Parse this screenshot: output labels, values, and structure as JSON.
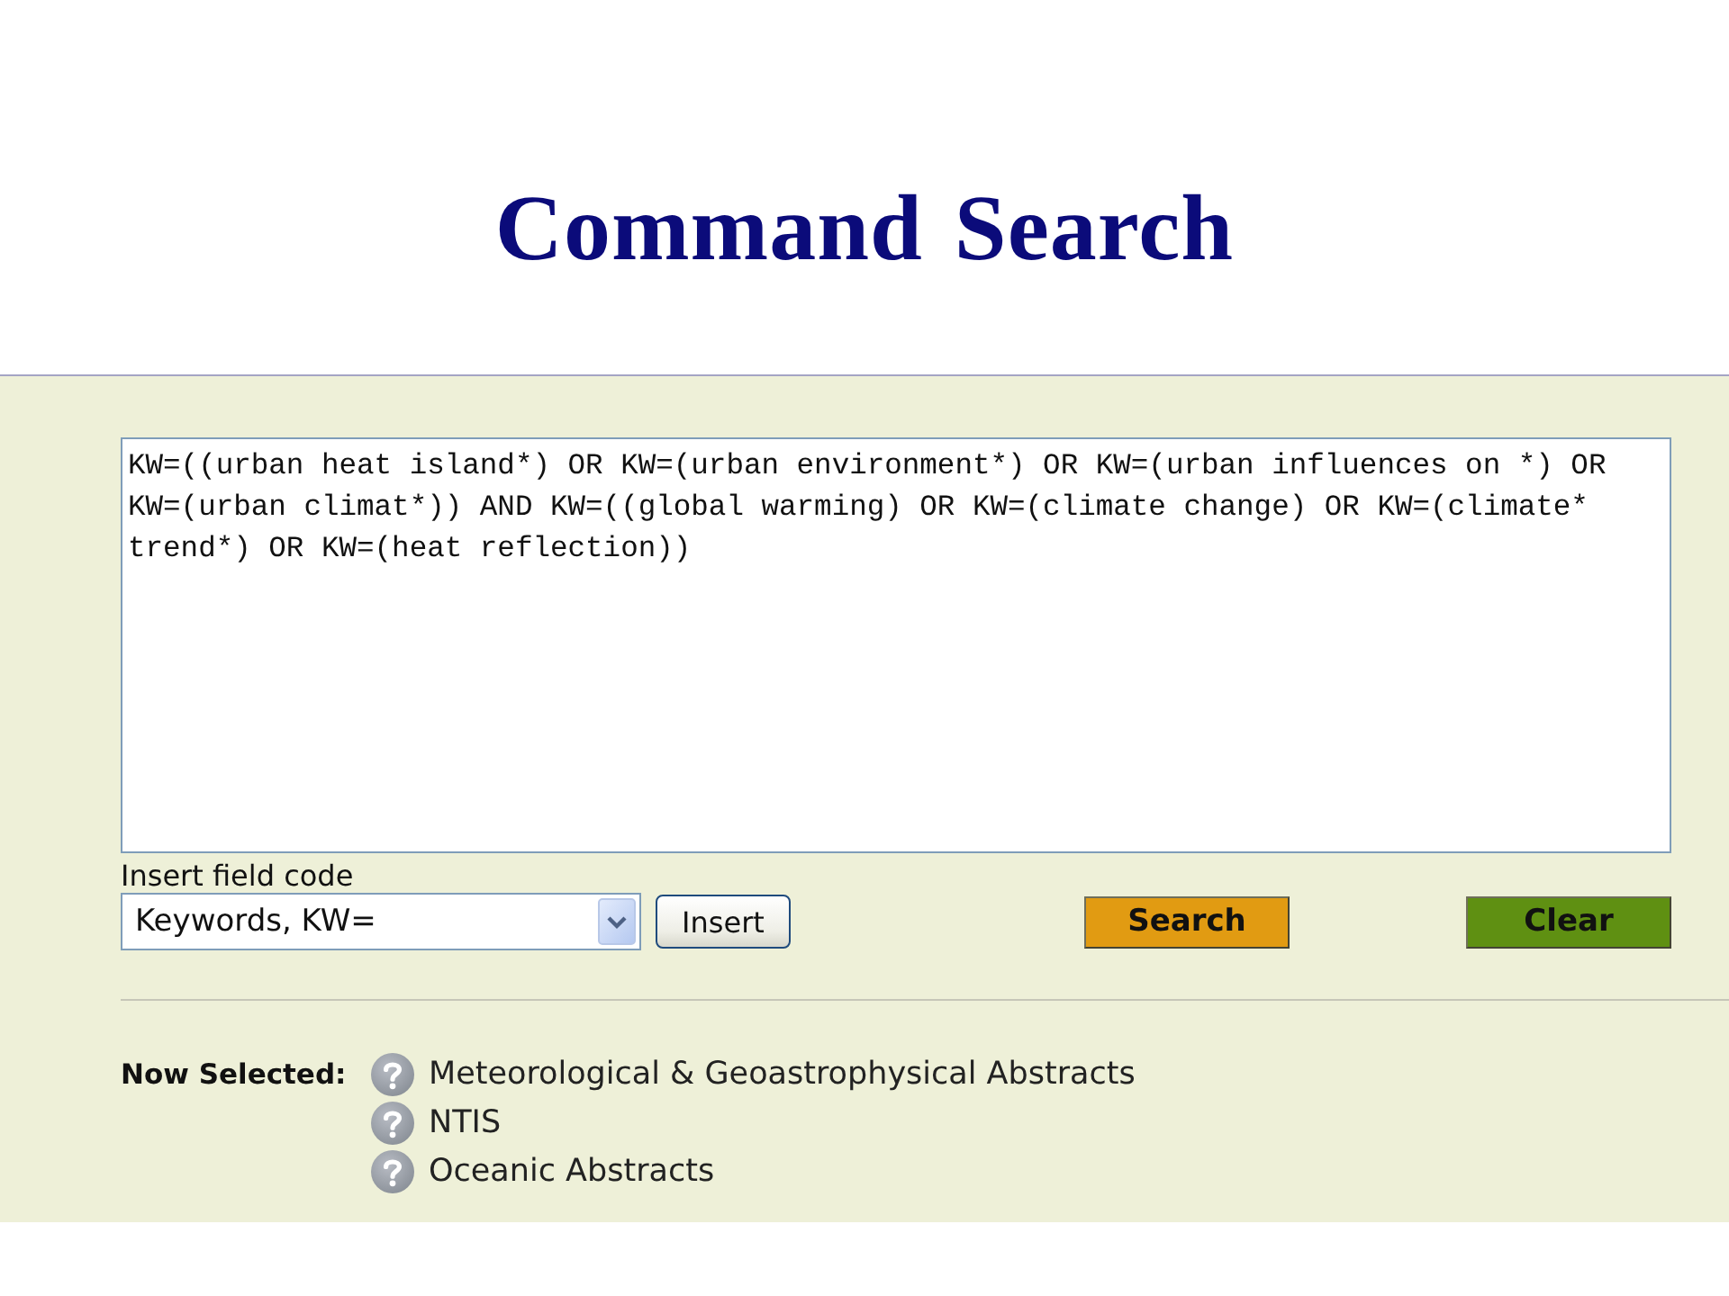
{
  "title": "Command Search",
  "query": {
    "value": "KW=((urban heat island*) OR KW=(urban environment*) OR KW=(urban influences on *) OR KW=(urban climat*)) AND KW=((global warming) OR KW=(climate change) OR KW=(climate* trend*) OR KW=(heat reflection))"
  },
  "field_code": {
    "label": "Insert field code",
    "select": {
      "value": "Keywords, KW="
    },
    "insert_button": "Insert"
  },
  "buttons": [
    {
      "label": "Search",
      "kind": "search"
    },
    {
      "label": "Clear",
      "kind": "clear"
    }
  ],
  "now_selected": {
    "label": "Now Selected:",
    "databases": [
      "Meteorological & Geoastrophysical Abstracts",
      "NTIS",
      "Oceanic Abstracts"
    ]
  }
}
